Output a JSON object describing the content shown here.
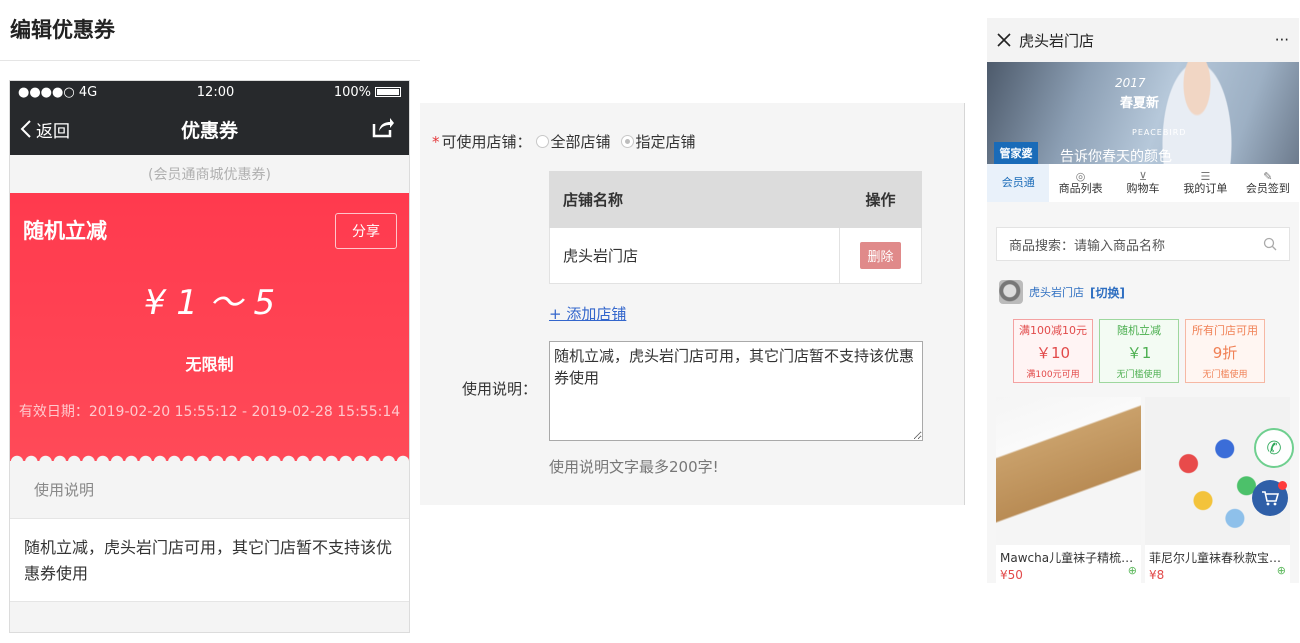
{
  "page": {
    "title": "编辑优惠券"
  },
  "phone": {
    "status": {
      "signal": "●●●●○ 4G",
      "time": "12:00",
      "battery": "100%"
    },
    "nav": {
      "back": "返回",
      "title": "优惠券"
    },
    "subtitle": "(会员通商城优惠券)",
    "coupon": {
      "name": "随机立减",
      "share": "分享",
      "amount": "¥ 1 ～ 5",
      "limit": "无限制",
      "valid": "有效日期：2019-02-20 15:55:12 - 2019-02-28 15:55:14",
      "color": "#ff3a4e"
    },
    "usage_head": "使用说明",
    "usage_text": "随机立减，虎头岩门店可用，其它门店暂不支持该优惠券使用"
  },
  "form": {
    "store_label": "可使用店铺：",
    "required_mark": "*",
    "radio_all": "全部店铺",
    "radio_selected": "指定店铺",
    "selected_option": "指定店铺",
    "table": {
      "headers": [
        "店铺名称",
        "操作"
      ],
      "rows": [
        {
          "name": "虎头岩门店",
          "action": "删除"
        }
      ]
    },
    "add_store": "+ 添加店铺",
    "desc_label": "使用说明：",
    "desc_value": "随机立减，虎头岩门店可用，其它门店暂不支持该优惠券使用",
    "desc_hint": "使用说明文字最多200字!"
  },
  "mini": {
    "title": "虎头岩门店",
    "more": "···",
    "banner": {
      "year": "2017",
      "season": "春夏新",
      "brand": "PEACEBIRD",
      "slogan": "告诉你春天的颜色",
      "logo": "管家婆"
    },
    "nav": [
      {
        "label": "会员通",
        "icon": ""
      },
      {
        "label": "商品列表",
        "icon": "◎"
      },
      {
        "label": "购物车",
        "icon": "⊻"
      },
      {
        "label": "我的订单",
        "icon": "☰"
      },
      {
        "label": "会员签到",
        "icon": "✎"
      }
    ],
    "search_placeholder": "商品搜索：请输入商品名称",
    "store_name": "虎头岩门店",
    "switch": "[切换]",
    "cards": [
      {
        "title": "满100减10元",
        "value": "￥10",
        "foot": "满100元可用",
        "color": "red"
      },
      {
        "title": "随机立减",
        "value": "￥1",
        "foot": "无门槛使用",
        "color": "green"
      },
      {
        "title": "所有门店可用",
        "value": "9折",
        "foot": "无门槛使用",
        "color": "orange"
      }
    ],
    "goods": [
      {
        "name": "Mawcha儿童袜子精梳…",
        "price": "¥50"
      },
      {
        "name": "菲尼尔儿童袜春秋款宝…",
        "price": "¥8"
      }
    ]
  }
}
